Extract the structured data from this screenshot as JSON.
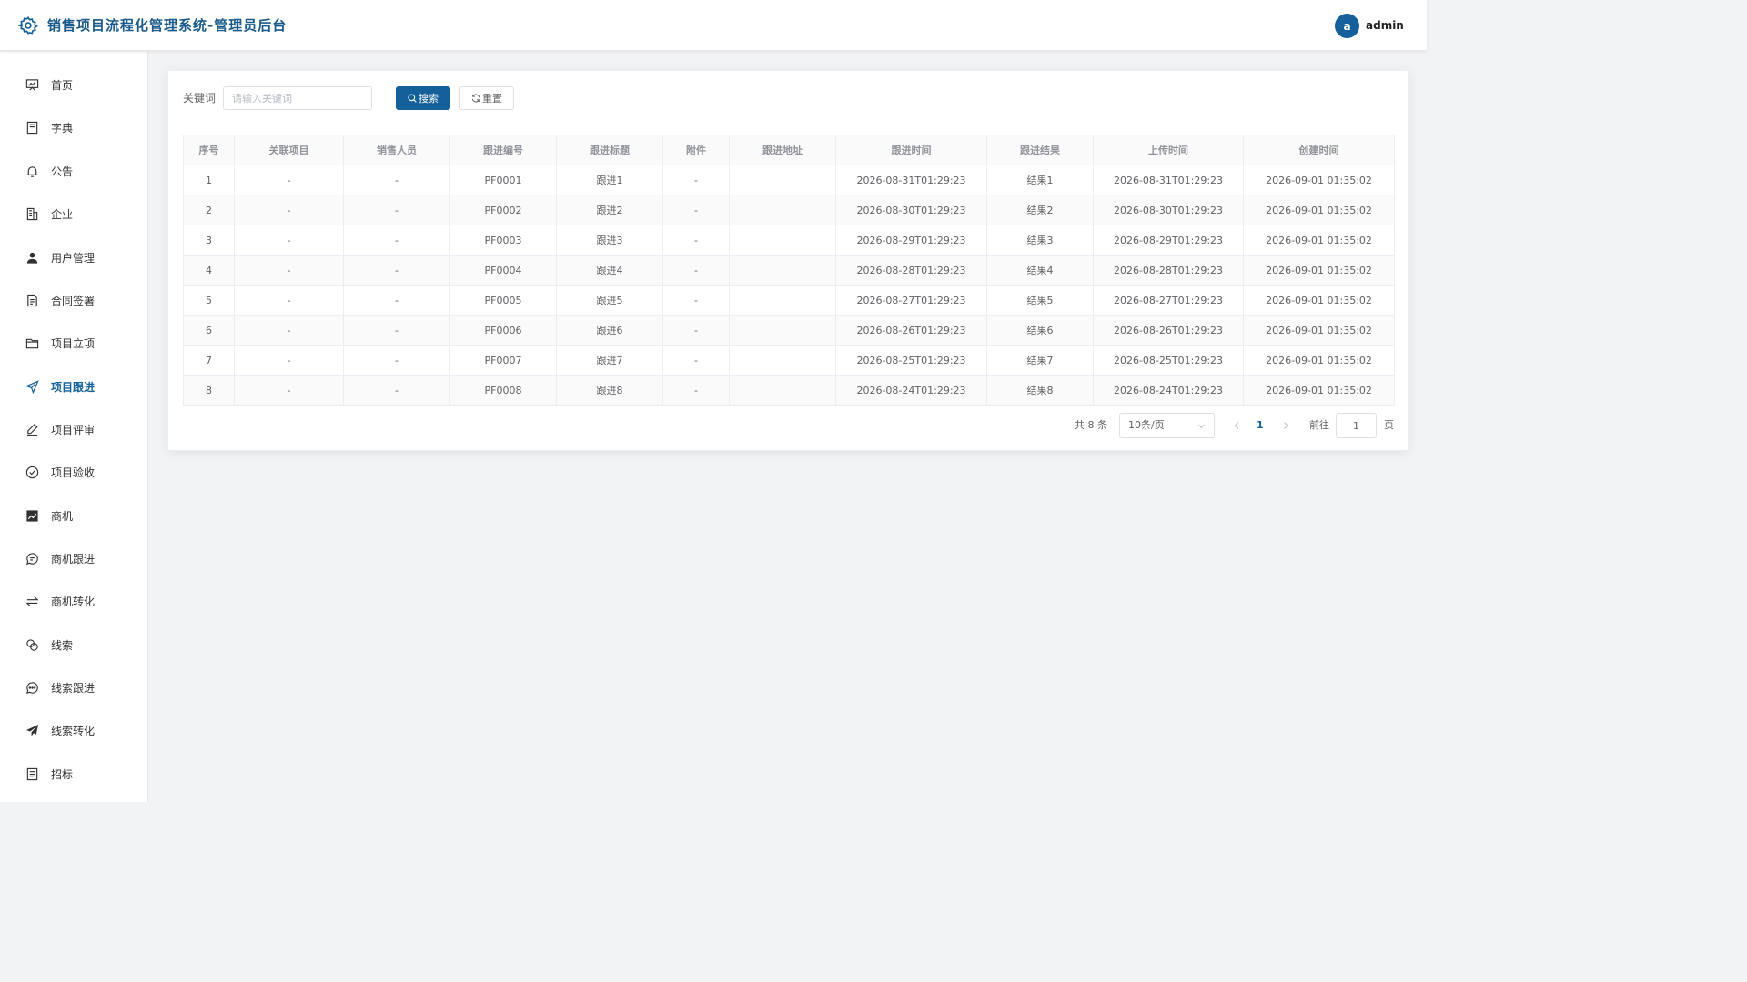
{
  "app": {
    "title": "销售项目流程化管理系统-管理员后台"
  },
  "user": {
    "avatar_letter": "a",
    "name": "admin"
  },
  "sidebar": {
    "items": [
      {
        "label": "首页",
        "icon": "chart-board-icon"
      },
      {
        "label": "字典",
        "icon": "book-icon"
      },
      {
        "label": "公告",
        "icon": "bell-icon"
      },
      {
        "label": "企业",
        "icon": "building-icon"
      },
      {
        "label": "用户管理",
        "icon": "user-icon"
      },
      {
        "label": "合同签署",
        "icon": "document-icon"
      },
      {
        "label": "项目立项",
        "icon": "folder-icon"
      },
      {
        "label": "项目跟进",
        "icon": "send-icon",
        "active": true
      },
      {
        "label": "项目评审",
        "icon": "pen-icon"
      },
      {
        "label": "项目验收",
        "icon": "check-circle-icon"
      },
      {
        "label": "商机",
        "icon": "trend-chart-icon"
      },
      {
        "label": "商机跟进",
        "icon": "chat-icon"
      },
      {
        "label": "商机转化",
        "icon": "switch-icon"
      },
      {
        "label": "线索",
        "icon": "link-icon"
      },
      {
        "label": "线索跟进",
        "icon": "chat-dots-icon"
      },
      {
        "label": "线索转化",
        "icon": "paper-plane-icon"
      },
      {
        "label": "招标",
        "icon": "tickets-icon"
      }
    ]
  },
  "search": {
    "label": "关键词",
    "placeholder": "请输入关键词",
    "value": "",
    "search_button": "搜索",
    "reset_button": "重置"
  },
  "table": {
    "columns": [
      "序号",
      "关联项目",
      "销售人员",
      "跟进编号",
      "跟进标题",
      "附件",
      "跟进地址",
      "跟进时间",
      "跟进结果",
      "上传时间",
      "创建时间"
    ],
    "rows": [
      [
        "1",
        "-",
        "-",
        "PF0001",
        "跟进1",
        "-",
        "",
        "2026-08-31T01:29:23",
        "结果1",
        "2026-08-31T01:29:23",
        "2026-09-01 01:35:02"
      ],
      [
        "2",
        "-",
        "-",
        "PF0002",
        "跟进2",
        "-",
        "",
        "2026-08-30T01:29:23",
        "结果2",
        "2026-08-30T01:29:23",
        "2026-09-01 01:35:02"
      ],
      [
        "3",
        "-",
        "-",
        "PF0003",
        "跟进3",
        "-",
        "",
        "2026-08-29T01:29:23",
        "结果3",
        "2026-08-29T01:29:23",
        "2026-09-01 01:35:02"
      ],
      [
        "4",
        "-",
        "-",
        "PF0004",
        "跟进4",
        "-",
        "",
        "2026-08-28T01:29:23",
        "结果4",
        "2026-08-28T01:29:23",
        "2026-09-01 01:35:02"
      ],
      [
        "5",
        "-",
        "-",
        "PF0005",
        "跟进5",
        "-",
        "",
        "2026-08-27T01:29:23",
        "结果5",
        "2026-08-27T01:29:23",
        "2026-09-01 01:35:02"
      ],
      [
        "6",
        "-",
        "-",
        "PF0006",
        "跟进6",
        "-",
        "",
        "2026-08-26T01:29:23",
        "结果6",
        "2026-08-26T01:29:23",
        "2026-09-01 01:35:02"
      ],
      [
        "7",
        "-",
        "-",
        "PF0007",
        "跟进7",
        "-",
        "",
        "2026-08-25T01:29:23",
        "结果7",
        "2026-08-25T01:29:23",
        "2026-09-01 01:35:02"
      ],
      [
        "8",
        "-",
        "-",
        "PF0008",
        "跟进8",
        "-",
        "",
        "2026-08-24T01:29:23",
        "结果8",
        "2026-08-24T01:29:23",
        "2026-09-01 01:35:02"
      ]
    ]
  },
  "pagination": {
    "total_text": "共 8 条",
    "page_size": "10条/页",
    "current_page": "1",
    "goto_label": "前往",
    "goto_value": "1",
    "page_suffix": "页"
  },
  "colors": {
    "primary": "#14609b",
    "border": "#ebeef5",
    "background": "#f2f3f5"
  }
}
